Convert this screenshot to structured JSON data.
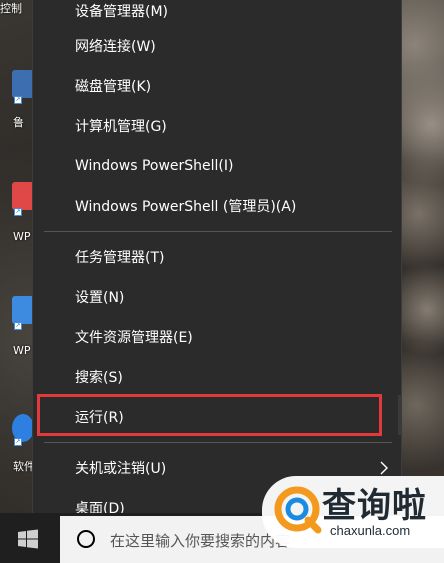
{
  "desktop": {
    "top_label": "控制",
    "icons": [
      {
        "label": "鲁",
        "color": "#3d6fb0"
      },
      {
        "label": "WP",
        "color": "#e04848"
      },
      {
        "label": "WP",
        "color": "#3d8be0"
      },
      {
        "label": "软件",
        "color": "#2d7fe0"
      }
    ]
  },
  "menu": {
    "items": [
      {
        "label": "设备管理器(M)"
      },
      {
        "label": "网络连接(W)"
      },
      {
        "label": "磁盘管理(K)"
      },
      {
        "label": "计算机管理(G)"
      },
      {
        "label": "Windows PowerShell(I)"
      },
      {
        "label": "Windows PowerShell (管理员)(A)"
      },
      {
        "label": "任务管理器(T)"
      },
      {
        "label": "设置(N)"
      },
      {
        "label": "文件资源管理器(E)"
      },
      {
        "label": "搜索(S)"
      },
      {
        "label": "运行(R)"
      },
      {
        "label": "关机或注销(U)"
      },
      {
        "label": "桌面(D)"
      }
    ],
    "highlight_color": "#e23a3a"
  },
  "taskbar": {
    "search_placeholder": "在这里输入你要搜索的内容"
  },
  "watermark": {
    "title": "查询啦",
    "subtitle": "chaxunla.com"
  }
}
